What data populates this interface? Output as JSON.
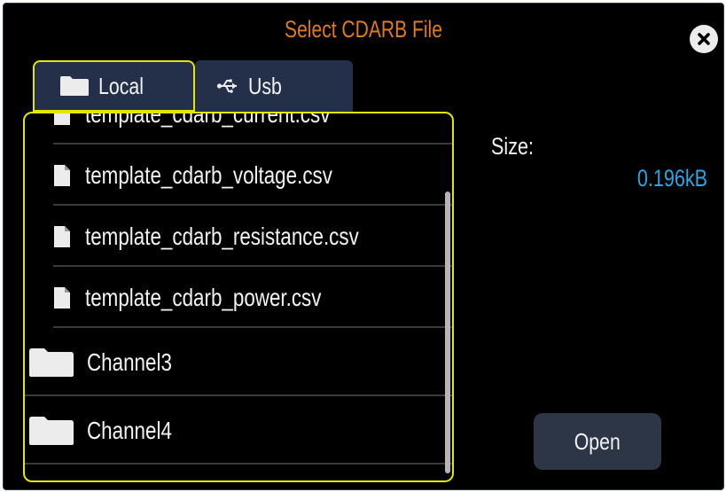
{
  "dialog": {
    "title": "Select CDARB File",
    "colors": {
      "title": "#e07a1a",
      "focus_border": "#e5e500",
      "size_value": "#2aa6e0",
      "tab_bg": "#243049"
    }
  },
  "tabs": [
    {
      "label": "Local",
      "icon": "folder-icon",
      "selected": true
    },
    {
      "label": "Usb",
      "icon": "usb-icon",
      "selected": false
    }
  ],
  "file_list": {
    "items": [
      {
        "type": "file",
        "name": "template_cdarb_current.csv",
        "icon": "file-icon"
      },
      {
        "type": "file",
        "name": "template_cdarb_voltage.csv",
        "icon": "file-icon"
      },
      {
        "type": "file",
        "name": "template_cdarb_resistance.csv",
        "icon": "file-icon"
      },
      {
        "type": "file",
        "name": "template_cdarb_power.csv",
        "icon": "file-icon"
      },
      {
        "type": "folder",
        "name": "Channel3",
        "icon": "folder-icon"
      },
      {
        "type": "folder",
        "name": "Channel4",
        "icon": "folder-icon"
      }
    ]
  },
  "details": {
    "size_label": "Size:",
    "size_value": "0.196kB"
  },
  "actions": {
    "open_label": "Open",
    "close_icon": "close-icon"
  }
}
